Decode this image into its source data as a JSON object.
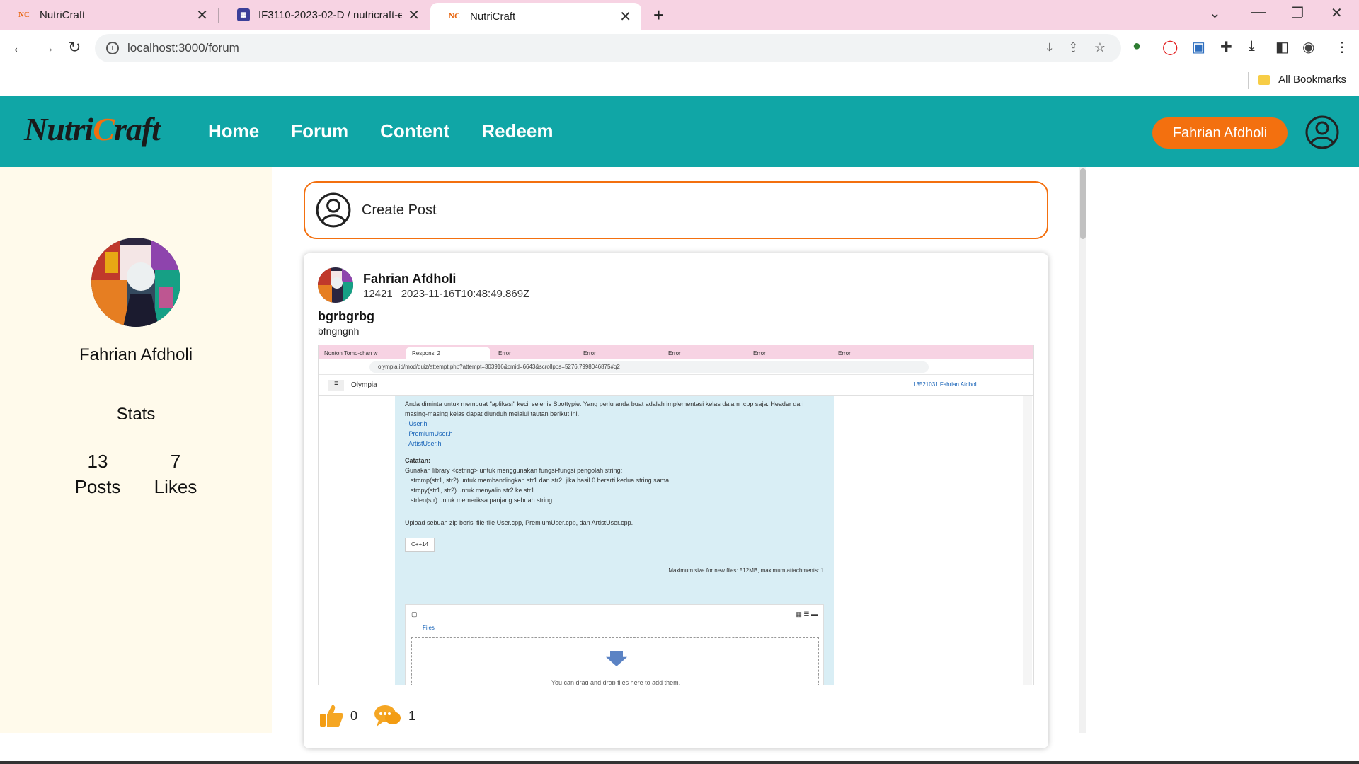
{
  "browser": {
    "tabs": [
      {
        "label": "NutriCraft",
        "favicon": "NC"
      },
      {
        "label": "IF3110-2023-02-D / nutricraft-e",
        "favicon": "GH"
      },
      {
        "label": "NutriCraft",
        "favicon": "NC"
      }
    ],
    "url": "localhost:3000/forum",
    "bookmarks_label": "All Bookmarks"
  },
  "app": {
    "logo_part1": "Nutri",
    "logo_part2": "C",
    "logo_part3": "raft",
    "nav": [
      "Home",
      "Forum",
      "Content",
      "Redeem"
    ],
    "user_button": "Fahrian Afdholi",
    "accent_color": "#f3700f",
    "header_color": "#10a6a6"
  },
  "sidebar": {
    "name": "Fahrian Afdholi",
    "stats_title": "Stats",
    "posts_count": "13",
    "posts_label": "Posts",
    "likes_count": "7",
    "likes_label": "Likes"
  },
  "create_post": {
    "label": "Create Post"
  },
  "post": {
    "author": "Fahrian Afdholi",
    "id": "12421",
    "timestamp": "2023-11-16T10:48:49.869Z",
    "title": "bgrbgrbg",
    "body": "bfngngnh",
    "likes": "0",
    "comments": "1",
    "embedded_screenshot": {
      "tabs": [
        "Nonton Tomo-chan w",
        "Responsi 2",
        "Error",
        "Error",
        "Error",
        "Error",
        "Error"
      ],
      "url": "olympia.id/mod/quiz/attempt.php?attempt=303916&cmid=6643&scrollpos=5276.7998046875#q2",
      "site": "Olympia",
      "user": "13521031 Fahrian Afdholi",
      "para1": "Anda diminta untuk membuat \"aplikasi\" kecil sejenis Spottypie. Yang perlu anda buat adalah implementasi kelas dalam .cpp saja. Header dari masing-masing kelas dapat diunduh melalui tautan berikut ini.",
      "links": [
        "- User.h",
        "- PremiumUser.h",
        "- ArtistUser.h"
      ],
      "catatan": "Catatan:",
      "lib_note": "Gunakan library <cstring> untuk menggunakan fungsi-fungsi pengolah string:",
      "bullets": [
        "strcmp(str1, str2) untuk membandingkan str1 dan str2, jika hasil 0 berarti kedua string sama.",
        "strcpy(str1, str2) untuk menyalin str2 ke str1",
        "strlen(str) untuk memeriksa panjang sebuah string"
      ],
      "upload_note": "Upload sebuah zip berisi file-file User.cpp, PremiumUser.cpp, dan ArtistUser.cpp.",
      "lang_select": "C++14",
      "max_size": "Maximum size for new files: 512MB, maximum attachments: 1",
      "files_label": "Files",
      "drop_text": "You can drag and drop files here to add them."
    }
  }
}
